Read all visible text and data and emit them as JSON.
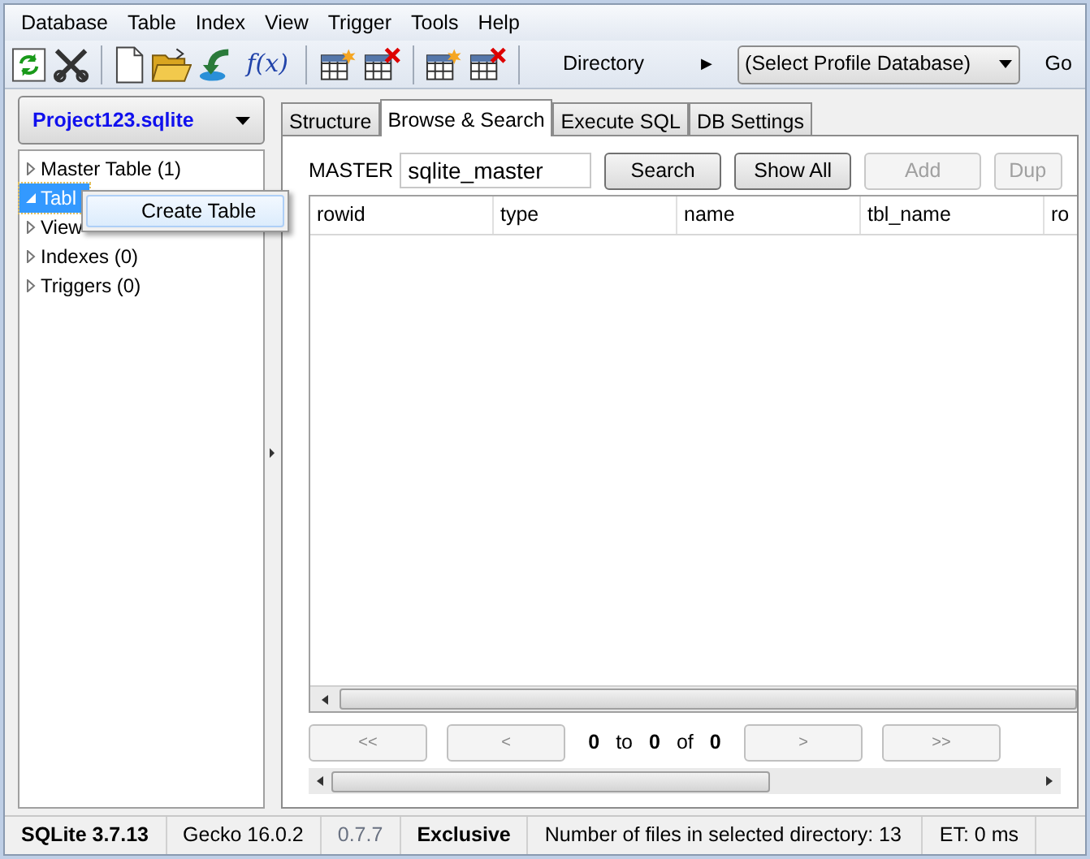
{
  "menu_bar": [
    "Database",
    "Table",
    "Index",
    "View",
    "Trigger",
    "Tools",
    "Help"
  ],
  "toolbar": {
    "function_label": "f(x)",
    "directory_label": "Directory",
    "directory_arrow": "▶",
    "profile_select": "(Select Profile Database)",
    "go_button": "Go"
  },
  "database_select": "Project123.sqlite",
  "tree": [
    {
      "label": "Master Table (1)",
      "expanded": false,
      "selected": false
    },
    {
      "label": "Tabl",
      "expanded": true,
      "selected": true
    },
    {
      "label": "View",
      "expanded": false,
      "selected": false
    },
    {
      "label": "Indexes (0)",
      "expanded": false,
      "selected": false
    },
    {
      "label": "Triggers (0)",
      "expanded": false,
      "selected": false
    }
  ],
  "context_menu": [
    "Create Table"
  ],
  "tabs": [
    {
      "label": "Structure",
      "selected": false
    },
    {
      "label": "Browse & Search",
      "selected": true
    },
    {
      "label": "Execute SQL",
      "selected": false
    },
    {
      "label": "DB Settings",
      "selected": false
    }
  ],
  "browse": {
    "table_label": "MASTER",
    "table_field": "sqlite_master",
    "buttons": [
      {
        "label": "Search",
        "disabled": false
      },
      {
        "label": "Show All",
        "disabled": false
      },
      {
        "label": "Add",
        "disabled": true
      },
      {
        "label": "Dup",
        "disabled": true
      }
    ],
    "columns": [
      "rowid",
      "type",
      "name",
      "tbl_name",
      "ro"
    ],
    "pagination": {
      "first": "<<",
      "prev": "<",
      "from": "0",
      "to_label": "to",
      "to": "0",
      "of_label": "of",
      "total": "0",
      "next": ">",
      "last": ">>"
    }
  },
  "status_bar": [
    {
      "text": "SQLite 3.7.13",
      "kind": "strong"
    },
    {
      "text": "Gecko 16.0.2",
      "kind": "plain"
    },
    {
      "text": "0.7.7",
      "kind": "dim"
    },
    {
      "text": "Exclusive",
      "kind": "strong"
    },
    {
      "text": "Number of files in selected directory: 13",
      "kind": "plain"
    },
    {
      "text": "ET: 0 ms",
      "kind": "plain"
    }
  ]
}
